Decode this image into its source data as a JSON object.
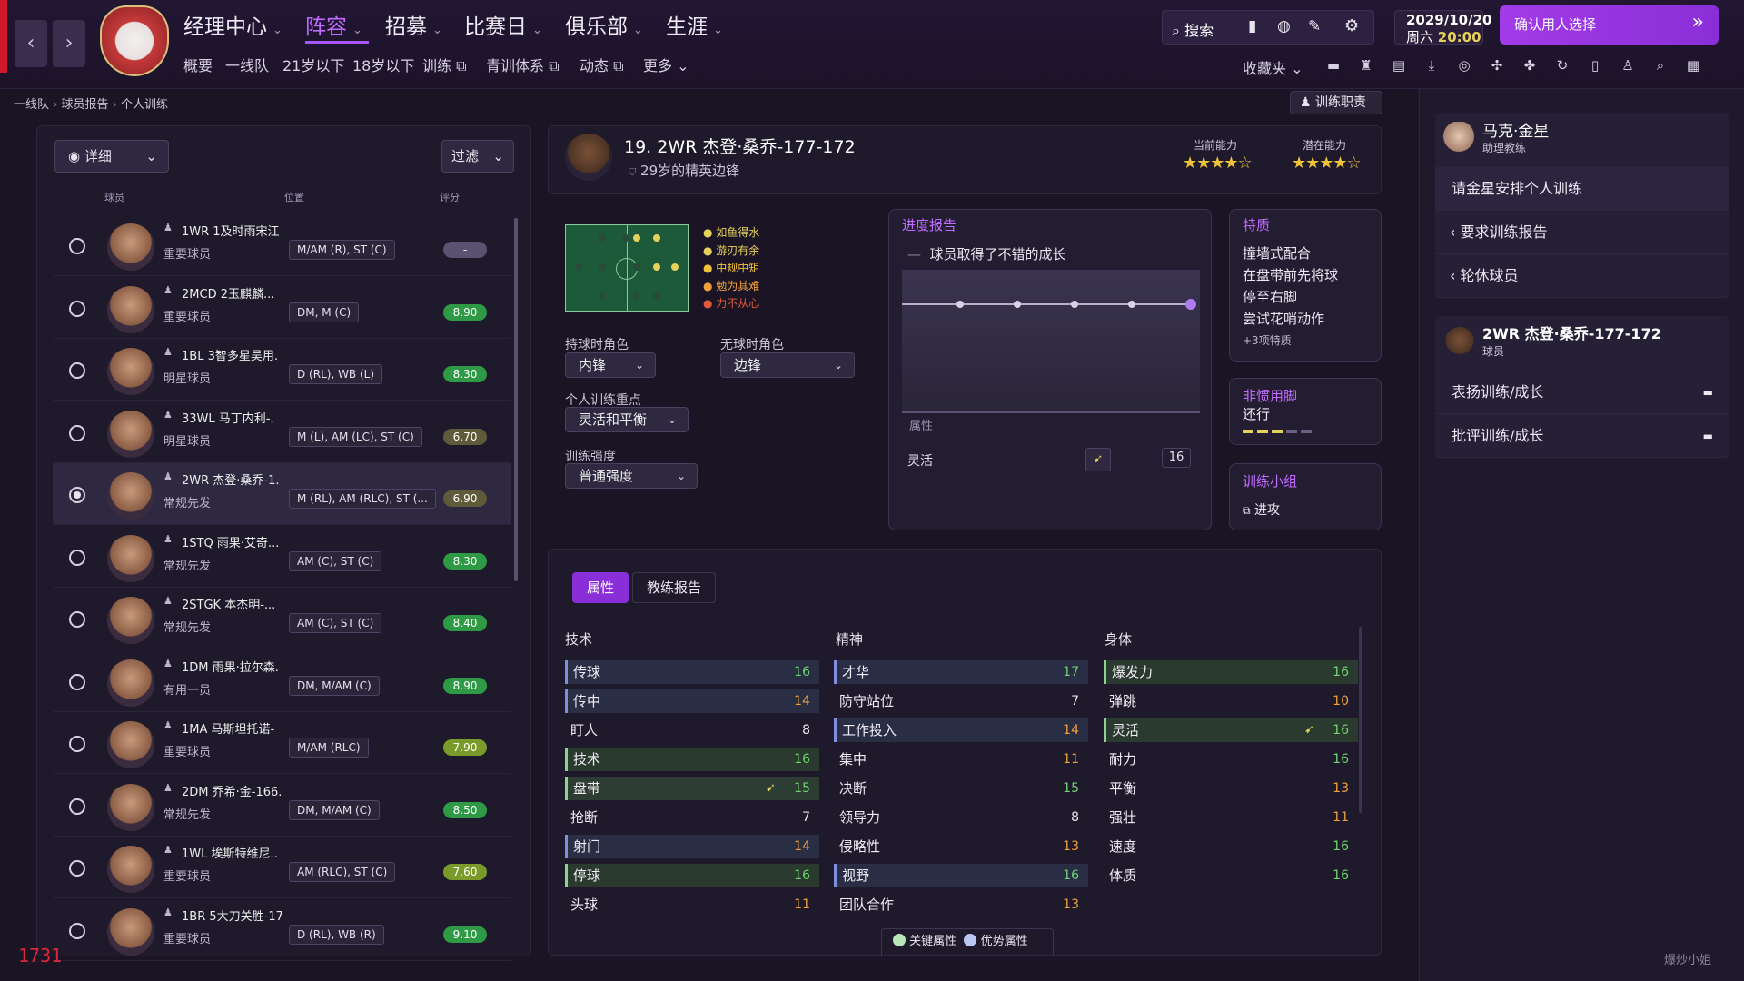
{
  "nav": {
    "back": "‹",
    "forward": "›",
    "menus": [
      "经理中心",
      "阵容",
      "招募",
      "比赛日",
      "俱乐部",
      "生涯"
    ],
    "active_menu": "阵容",
    "sub": [
      "概要",
      "一线队",
      "21岁以下",
      "18岁以下",
      "训练",
      "青训体系",
      "动态",
      "更多"
    ],
    "search_label": "搜索",
    "date": "2029/10/20",
    "weekday": "周六",
    "time": "20:00",
    "confirm_button": "确认用人选择",
    "favorites": "收藏夹"
  },
  "breadcrumb": [
    "一线队",
    "球员报告",
    "个人训练"
  ],
  "training_duties": "训练职责",
  "left": {
    "view_label": "详细",
    "filter_label": "过滤",
    "headers": [
      "球员",
      "位置",
      "评分"
    ],
    "players": [
      {
        "name": "1WR 1及时雨宋江",
        "cat": "重要球员",
        "pos": "M/AM (R), ST (C)",
        "rating": "-",
        "color": "#5a5270"
      },
      {
        "name": "2MCD 2玉麒麟...",
        "cat": "重要球员",
        "pos": "DM, M (C)",
        "rating": "8.90",
        "color": "#2f9a45"
      },
      {
        "name": "1BL 3智多星吴用.",
        "cat": "明星球员",
        "pos": "D (RL), WB (L)",
        "rating": "8.30",
        "color": "#2f9a45"
      },
      {
        "name": "33WL 马丁内利-.",
        "cat": "明星球员",
        "pos": "M (L), AM (LC), ST (C)",
        "rating": "6.70",
        "color": "#5f5a3a"
      },
      {
        "name": "2WR 杰登·桑乔-1.",
        "cat": "常规先发",
        "pos": "M (RL), AM (RLC), ST (...",
        "rating": "6.90",
        "color": "#5f5a3a"
      },
      {
        "name": "1STQ 雨果·艾奇...",
        "cat": "常规先发",
        "pos": "AM (C), ST (C)",
        "rating": "8.30",
        "color": "#2f9a45"
      },
      {
        "name": "2STGK 本杰明-...",
        "cat": "常规先发",
        "pos": "AM (C), ST (C)",
        "rating": "8.40",
        "color": "#2f9a45"
      },
      {
        "name": "1DM 雨果·拉尔森.",
        "cat": "有用一员",
        "pos": "DM, M/AM (C)",
        "rating": "8.90",
        "color": "#2f9a45"
      },
      {
        "name": "1MA 马斯坦托诺-",
        "cat": "重要球员",
        "pos": "M/AM (RLC)",
        "rating": "7.90",
        "color": "#7a9a2a"
      },
      {
        "name": "2DM 乔希·金-166.",
        "cat": "常规先发",
        "pos": "DM, M/AM (C)",
        "rating": "8.50",
        "color": "#2f9a45"
      },
      {
        "name": "1WL 埃斯特维尼..",
        "cat": "重要球员",
        "pos": "AM (RLC), ST (C)",
        "rating": "7.60",
        "color": "#7a9a2a"
      },
      {
        "name": "1BR 5大刀关胜-17",
        "cat": "重要球员",
        "pos": "D (RL), WB (R)",
        "rating": "9.10",
        "color": "#2f9a45"
      }
    ],
    "selected_index": 4,
    "corner_number": "1731"
  },
  "player": {
    "title": "19. 2WR 杰登·桑乔-177-172",
    "desc": "29岁的精英边锋",
    "current_ability_label": "当前能力",
    "potential_ability_label": "潜在能力",
    "current_stars": "★★★★☆",
    "potential_stars": "★★★★☆",
    "traits_list": [
      "如鱼得水",
      "游刃有余",
      "中规中矩",
      "勉为其难",
      "力不从心"
    ],
    "in_possession_label": "持球时角色",
    "in_possession_value": "内锋",
    "out_possession_label": "无球时角色",
    "out_possession_value": "边锋",
    "focus_label": "个人训练重点",
    "focus_value": "灵活和平衡",
    "intensity_label": "训练强度",
    "intensity_value": "普通强度"
  },
  "progress": {
    "title": "进度报告",
    "summary": "球员取得了不错的成长",
    "attr_header": "属性",
    "attr_name": "灵活",
    "attr_value": "16"
  },
  "traits": {
    "title": "特质",
    "items": [
      "撞墙式配合",
      "在盘带前先将球",
      "停至右脚",
      "尝试花哨动作",
      "+3项特质"
    ]
  },
  "weak_foot": {
    "title": "非惯用脚",
    "value": "还行"
  },
  "group": {
    "title": "训练小组",
    "value": "进攻"
  },
  "tabs": [
    "属性",
    "教练报告"
  ],
  "attributes": {
    "technical_title": "技术",
    "mental_title": "精神",
    "physical_title": "身体",
    "technical": [
      [
        "传球",
        "16",
        "g",
        "pri"
      ],
      [
        "传中",
        "14",
        "o",
        "pri"
      ],
      [
        "盯人",
        "8",
        "w",
        "plain"
      ],
      [
        "技术",
        "16",
        "g",
        "key"
      ],
      [
        "盘带",
        "15",
        "g",
        "both"
      ],
      [
        "抢断",
        "7",
        "w",
        "plain"
      ],
      [
        "射门",
        "14",
        "o",
        "pri"
      ],
      [
        "停球",
        "16",
        "g",
        "key"
      ],
      [
        "头球",
        "11",
        "o",
        "plain"
      ]
    ],
    "mental": [
      [
        "才华",
        "17",
        "g",
        "pri"
      ],
      [
        "防守站位",
        "7",
        "w",
        "plain"
      ],
      [
        "工作投入",
        "14",
        "o",
        "pri"
      ],
      [
        "集中",
        "11",
        "o",
        "plain"
      ],
      [
        "决断",
        "15",
        "g",
        "plain"
      ],
      [
        "领导力",
        "8",
        "w",
        "plain"
      ],
      [
        "侵略性",
        "13",
        "o",
        "plain"
      ],
      [
        "视野",
        "16",
        "g",
        "pri"
      ],
      [
        "团队合作",
        "13",
        "o",
        "plain"
      ]
    ],
    "physical": [
      [
        "爆发力",
        "16",
        "g",
        "key"
      ],
      [
        "弹跳",
        "10",
        "o",
        "plain"
      ],
      [
        "灵活",
        "16",
        "g",
        "key"
      ],
      [
        "耐力",
        "16",
        "g",
        "plain"
      ],
      [
        "平衡",
        "13",
        "o",
        "plain"
      ],
      [
        "强壮",
        "11",
        "o",
        "plain"
      ],
      [
        "速度",
        "16",
        "g",
        "plain"
      ],
      [
        "体质",
        "16",
        "g",
        "plain"
      ]
    ],
    "legend_key": "关键属性",
    "legend_pri": "优势属性"
  },
  "right": {
    "coach_name": "马克·金星",
    "coach_role": "助理教练",
    "action1": "请金星安排个人训练",
    "action2": "要求训练报告",
    "action3": "轮休球员",
    "player_name": "2WR 杰登·桑乔-177-172",
    "player_role": "球员",
    "praise": "表扬训练/成长",
    "criticize": "批评训练/成长"
  },
  "watermark": "爆炒小姐"
}
